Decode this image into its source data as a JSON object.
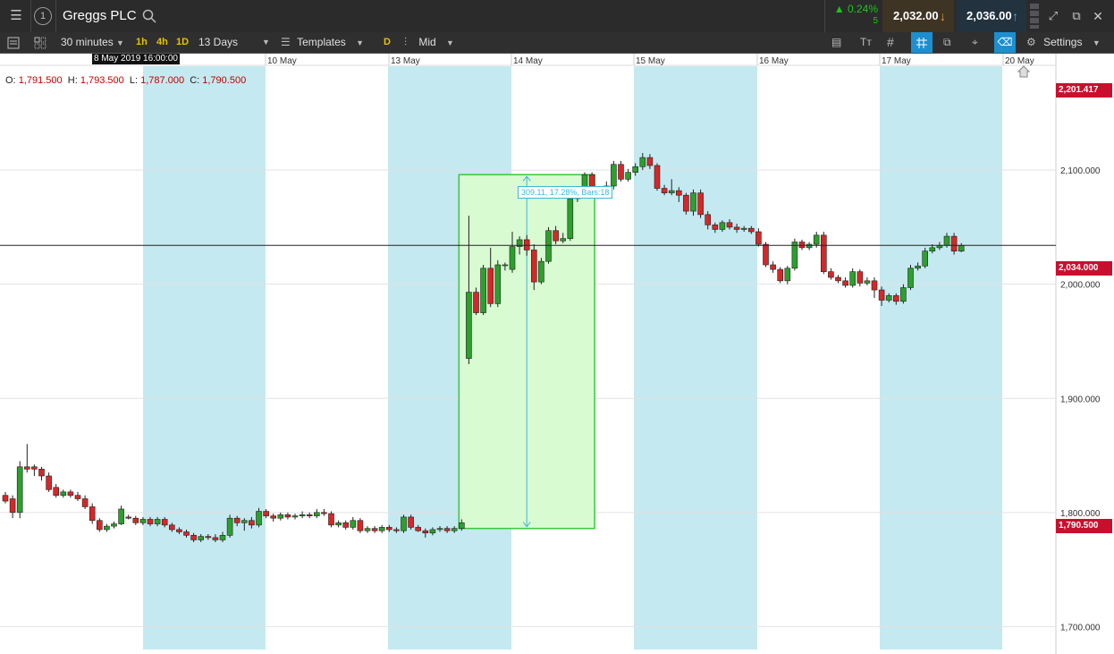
{
  "header": {
    "instrument": "Greggs PLC",
    "change_pct": "▲ 0.24%",
    "change_pts": "5",
    "sell_price": "2,032.00",
    "buy_price": "2,036.00",
    "window_number": "1"
  },
  "toolbar": {
    "interval": "30 minutes",
    "quick_1h": "1h",
    "quick_4h": "4h",
    "quick_1d": "1D",
    "range": "13 Days",
    "templates": "Templates",
    "d_label": "D",
    "price_type": "Mid",
    "settings": "Settings"
  },
  "ohlc": {
    "o_label": "O:",
    "o": "1,791.500",
    "h_label": "H:",
    "h": "1,793.500",
    "l_label": "L:",
    "l": "1,787.000",
    "c_label": "C:",
    "c": "1,790.500"
  },
  "crosshair_date": "8 May 2019 16:00:00",
  "measure_label": "309.11, 17.28%, Bars:18",
  "badges": {
    "top": "2,201.417",
    "current": "2,034.000",
    "last": "1,790.500"
  },
  "colors": {
    "up": "#2ca02c",
    "down": "#d62728",
    "session_band": "#c5e9f0",
    "measure_fill": "#d8fbd2",
    "measure_border": "#36c93a",
    "measure_arrow": "#3cb8d6",
    "badge": "#c8102e"
  },
  "chart_data": {
    "type": "candlestick",
    "x_labels": [
      "10 May",
      "13 May",
      "14 May",
      "15 May",
      "16 May",
      "17 May",
      "20 May"
    ],
    "y_ticks": [
      "2,100.000",
      "2,000.000",
      "1,900.000",
      "1,800.000",
      "1,700.000"
    ],
    "y_tick_values": [
      2100,
      2000,
      1900,
      1800,
      1700
    ],
    "ylim": [
      1676,
      2202
    ],
    "horizontal_line": 2034,
    "candles": [
      [
        1815,
        1810,
        1818,
        1808
      ],
      [
        1812,
        1800,
        1815,
        1795
      ],
      [
        1800,
        1840,
        1845,
        1795
      ],
      [
        1840,
        1838,
        1860,
        1835
      ],
      [
        1840,
        1838,
        1842,
        1832
      ],
      [
        1838,
        1832,
        1840,
        1828
      ],
      [
        1832,
        1820,
        1835,
        1818
      ],
      [
        1822,
        1815,
        1825,
        1813
      ],
      [
        1815,
        1818,
        1820,
        1813
      ],
      [
        1818,
        1815,
        1820,
        1813
      ],
      [
        1815,
        1812,
        1818,
        1810
      ],
      [
        1812,
        1805,
        1815,
        1803
      ],
      [
        1805,
        1793,
        1808,
        1790
      ],
      [
        1793,
        1785,
        1795,
        1783
      ],
      [
        1785,
        1788,
        1790,
        1783
      ],
      [
        1788,
        1790,
        1792,
        1786
      ],
      [
        1790,
        1803,
        1806,
        1789
      ],
      [
        1796,
        1795,
        1798,
        1794
      ],
      [
        1795,
        1791,
        1797,
        1789
      ],
      [
        1791,
        1794,
        1796,
        1789
      ],
      [
        1794,
        1790,
        1796,
        1788
      ],
      [
        1790,
        1794,
        1796,
        1788
      ],
      [
        1794,
        1789,
        1796,
        1787
      ],
      [
        1789,
        1785,
        1791,
        1783
      ],
      [
        1785,
        1783,
        1787,
        1781
      ],
      [
        1783,
        1780,
        1785,
        1778
      ],
      [
        1780,
        1776,
        1782,
        1774
      ],
      [
        1776,
        1779,
        1781,
        1774
      ],
      [
        1779,
        1778,
        1781,
        1776
      ],
      [
        1778,
        1776,
        1781,
        1774
      ],
      [
        1776,
        1780,
        1783,
        1774
      ],
      [
        1780,
        1795,
        1798,
        1778
      ],
      [
        1795,
        1791,
        1797,
        1788
      ],
      [
        1791,
        1793,
        1795,
        1784
      ],
      [
        1793,
        1789,
        1796,
        1786
      ],
      [
        1789,
        1801,
        1804,
        1787
      ],
      [
        1801,
        1797,
        1803,
        1795
      ],
      [
        1797,
        1795,
        1799,
        1792
      ],
      [
        1795,
        1798,
        1800,
        1793
      ],
      [
        1798,
        1796,
        1800,
        1794
      ],
      [
        1796,
        1797,
        1799,
        1794
      ],
      [
        1797,
        1798,
        1801,
        1795
      ],
      [
        1798,
        1797,
        1800,
        1795
      ],
      [
        1797,
        1800,
        1803,
        1795
      ],
      [
        1800,
        1799,
        1803,
        1797
      ],
      [
        1799,
        1789,
        1801,
        1787
      ],
      [
        1789,
        1791,
        1793,
        1787
      ],
      [
        1791,
        1787,
        1793,
        1785
      ],
      [
        1787,
        1793,
        1796,
        1785
      ],
      [
        1793,
        1784,
        1795,
        1782
      ],
      [
        1784,
        1786,
        1788,
        1782
      ],
      [
        1786,
        1784,
        1788,
        1782
      ],
      [
        1784,
        1787,
        1789,
        1782
      ],
      [
        1787,
        1785,
        1789,
        1783
      ],
      [
        1785,
        1784,
        1787,
        1782
      ],
      [
        1784,
        1796,
        1798,
        1782
      ],
      [
        1796,
        1787,
        1798,
        1785
      ],
      [
        1787,
        1784,
        1789,
        1783
      ],
      [
        1784,
        1782,
        1786,
        1778
      ],
      [
        1782,
        1785,
        1787,
        1780
      ],
      [
        1785,
        1786,
        1788,
        1783
      ],
      [
        1786,
        1784,
        1788,
        1782
      ],
      [
        1784,
        1786,
        1788,
        1782
      ],
      [
        1786,
        1791,
        1794,
        1784
      ],
      [
        1935,
        1993,
        2060,
        1930
      ],
      [
        1993,
        1975,
        1997,
        1973
      ],
      [
        1975,
        2014,
        2017,
        1973
      ],
      [
        2014,
        1983,
        2032,
        1980
      ],
      [
        1983,
        2017,
        2021,
        1980
      ],
      [
        2017,
        2017,
        2019,
        2012
      ],
      [
        2013,
        2033,
        2046,
        2010
      ],
      [
        2033,
        2039,
        2042,
        2026
      ],
      [
        2039,
        2030,
        2043,
        2025
      ],
      [
        2030,
        2002,
        2035,
        1995
      ],
      [
        2002,
        2020,
        2023,
        2000
      ],
      [
        2020,
        2047,
        2050,
        2018
      ],
      [
        2047,
        2038,
        2051,
        2035
      ],
      [
        2038,
        2040,
        2045,
        2036
      ],
      [
        2040,
        2075,
        2078,
        2038
      ],
      [
        2075,
        2080,
        2084,
        2072
      ],
      [
        2080,
        2096,
        2098,
        2076
      ],
      [
        2096,
        2082,
        2098,
        2080
      ],
      [
        2082,
        2080,
        2086,
        2078
      ],
      [
        2080,
        2086,
        2090,
        2078
      ],
      [
        2086,
        2105,
        2108,
        2083
      ],
      [
        2105,
        2092,
        2108,
        2090
      ],
      [
        2092,
        2098,
        2101,
        2090
      ],
      [
        2098,
        2103,
        2106,
        2095
      ],
      [
        2103,
        2111,
        2115,
        2100
      ],
      [
        2111,
        2104,
        2114,
        2101
      ],
      [
        2104,
        2084,
        2106,
        2082
      ],
      [
        2084,
        2080,
        2087,
        2078
      ],
      [
        2080,
        2082,
        2092,
        2078
      ],
      [
        2082,
        2078,
        2085,
        2072
      ],
      [
        2078,
        2064,
        2080,
        2061
      ],
      [
        2064,
        2080,
        2083,
        2060
      ],
      [
        2080,
        2061,
        2083,
        2058
      ],
      [
        2061,
        2052,
        2064,
        2048
      ],
      [
        2052,
        2048,
        2054,
        2045
      ],
      [
        2048,
        2054,
        2056,
        2046
      ],
      [
        2054,
        2050,
        2057,
        2048
      ],
      [
        2050,
        2048,
        2053,
        2045
      ],
      [
        2048,
        2049,
        2051,
        2046
      ],
      [
        2049,
        2046,
        2051,
        2044
      ],
      [
        2046,
        2035,
        2049,
        2033
      ],
      [
        2035,
        2017,
        2037,
        2015
      ],
      [
        2017,
        2013,
        2020,
        2010
      ],
      [
        2013,
        2003,
        2015,
        2001
      ],
      [
        2003,
        2014,
        2016,
        2000
      ],
      [
        2014,
        2037,
        2040,
        2012
      ],
      [
        2037,
        2032,
        2039,
        2030
      ],
      [
        2032,
        2035,
        2037,
        2030
      ],
      [
        2035,
        2043,
        2046,
        2032
      ],
      [
        2043,
        2011,
        2046,
        2009
      ],
      [
        2011,
        2006,
        2014,
        2004
      ],
      [
        2006,
        2003,
        2008,
        2001
      ],
      [
        2003,
        1999,
        2006,
        1997
      ],
      [
        1999,
        2011,
        2014,
        1997
      ],
      [
        2011,
        2001,
        2013,
        1998
      ],
      [
        2001,
        2003,
        2006,
        1999
      ],
      [
        2003,
        1995,
        2006,
        1988
      ],
      [
        1995,
        1986,
        1998,
        1981
      ],
      [
        1986,
        1990,
        1992,
        1984
      ],
      [
        1990,
        1985,
        1992,
        1982
      ],
      [
        1985,
        1997,
        2000,
        1983
      ],
      [
        1997,
        2014,
        2017,
        1995
      ],
      [
        2014,
        2016,
        2019,
        2012
      ],
      [
        2016,
        2029,
        2032,
        2014
      ],
      [
        2029,
        2032,
        2035,
        2027
      ],
      [
        2032,
        2034,
        2037,
        2030
      ],
      [
        2034,
        2042,
        2045,
        2032
      ],
      [
        2042,
        2029,
        2045,
        2026
      ],
      [
        2029,
        2034,
        2036,
        2028
      ]
    ]
  }
}
